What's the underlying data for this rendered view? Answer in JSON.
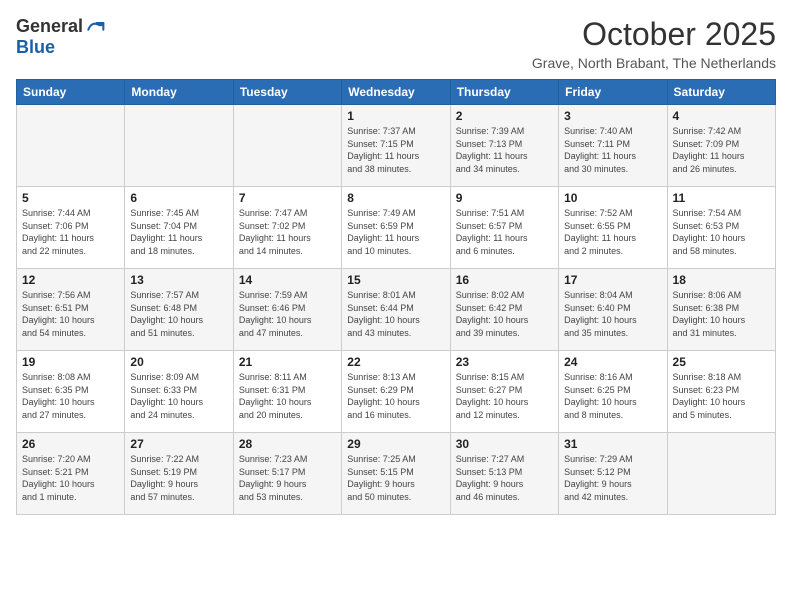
{
  "logo": {
    "general": "General",
    "blue": "Blue"
  },
  "header": {
    "month": "October 2025",
    "location": "Grave, North Brabant, The Netherlands"
  },
  "weekdays": [
    "Sunday",
    "Monday",
    "Tuesday",
    "Wednesday",
    "Thursday",
    "Friday",
    "Saturday"
  ],
  "weeks": [
    [
      {
        "day": "",
        "info": ""
      },
      {
        "day": "",
        "info": ""
      },
      {
        "day": "",
        "info": ""
      },
      {
        "day": "1",
        "info": "Sunrise: 7:37 AM\nSunset: 7:15 PM\nDaylight: 11 hours\nand 38 minutes."
      },
      {
        "day": "2",
        "info": "Sunrise: 7:39 AM\nSunset: 7:13 PM\nDaylight: 11 hours\nand 34 minutes."
      },
      {
        "day": "3",
        "info": "Sunrise: 7:40 AM\nSunset: 7:11 PM\nDaylight: 11 hours\nand 30 minutes."
      },
      {
        "day": "4",
        "info": "Sunrise: 7:42 AM\nSunset: 7:09 PM\nDaylight: 11 hours\nand 26 minutes."
      }
    ],
    [
      {
        "day": "5",
        "info": "Sunrise: 7:44 AM\nSunset: 7:06 PM\nDaylight: 11 hours\nand 22 minutes."
      },
      {
        "day": "6",
        "info": "Sunrise: 7:45 AM\nSunset: 7:04 PM\nDaylight: 11 hours\nand 18 minutes."
      },
      {
        "day": "7",
        "info": "Sunrise: 7:47 AM\nSunset: 7:02 PM\nDaylight: 11 hours\nand 14 minutes."
      },
      {
        "day": "8",
        "info": "Sunrise: 7:49 AM\nSunset: 6:59 PM\nDaylight: 11 hours\nand 10 minutes."
      },
      {
        "day": "9",
        "info": "Sunrise: 7:51 AM\nSunset: 6:57 PM\nDaylight: 11 hours\nand 6 minutes."
      },
      {
        "day": "10",
        "info": "Sunrise: 7:52 AM\nSunset: 6:55 PM\nDaylight: 11 hours\nand 2 minutes."
      },
      {
        "day": "11",
        "info": "Sunrise: 7:54 AM\nSunset: 6:53 PM\nDaylight: 10 hours\nand 58 minutes."
      }
    ],
    [
      {
        "day": "12",
        "info": "Sunrise: 7:56 AM\nSunset: 6:51 PM\nDaylight: 10 hours\nand 54 minutes."
      },
      {
        "day": "13",
        "info": "Sunrise: 7:57 AM\nSunset: 6:48 PM\nDaylight: 10 hours\nand 51 minutes."
      },
      {
        "day": "14",
        "info": "Sunrise: 7:59 AM\nSunset: 6:46 PM\nDaylight: 10 hours\nand 47 minutes."
      },
      {
        "day": "15",
        "info": "Sunrise: 8:01 AM\nSunset: 6:44 PM\nDaylight: 10 hours\nand 43 minutes."
      },
      {
        "day": "16",
        "info": "Sunrise: 8:02 AM\nSunset: 6:42 PM\nDaylight: 10 hours\nand 39 minutes."
      },
      {
        "day": "17",
        "info": "Sunrise: 8:04 AM\nSunset: 6:40 PM\nDaylight: 10 hours\nand 35 minutes."
      },
      {
        "day": "18",
        "info": "Sunrise: 8:06 AM\nSunset: 6:38 PM\nDaylight: 10 hours\nand 31 minutes."
      }
    ],
    [
      {
        "day": "19",
        "info": "Sunrise: 8:08 AM\nSunset: 6:35 PM\nDaylight: 10 hours\nand 27 minutes."
      },
      {
        "day": "20",
        "info": "Sunrise: 8:09 AM\nSunset: 6:33 PM\nDaylight: 10 hours\nand 24 minutes."
      },
      {
        "day": "21",
        "info": "Sunrise: 8:11 AM\nSunset: 6:31 PM\nDaylight: 10 hours\nand 20 minutes."
      },
      {
        "day": "22",
        "info": "Sunrise: 8:13 AM\nSunset: 6:29 PM\nDaylight: 10 hours\nand 16 minutes."
      },
      {
        "day": "23",
        "info": "Sunrise: 8:15 AM\nSunset: 6:27 PM\nDaylight: 10 hours\nand 12 minutes."
      },
      {
        "day": "24",
        "info": "Sunrise: 8:16 AM\nSunset: 6:25 PM\nDaylight: 10 hours\nand 8 minutes."
      },
      {
        "day": "25",
        "info": "Sunrise: 8:18 AM\nSunset: 6:23 PM\nDaylight: 10 hours\nand 5 minutes."
      }
    ],
    [
      {
        "day": "26",
        "info": "Sunrise: 7:20 AM\nSunset: 5:21 PM\nDaylight: 10 hours\nand 1 minute."
      },
      {
        "day": "27",
        "info": "Sunrise: 7:22 AM\nSunset: 5:19 PM\nDaylight: 9 hours\nand 57 minutes."
      },
      {
        "day": "28",
        "info": "Sunrise: 7:23 AM\nSunset: 5:17 PM\nDaylight: 9 hours\nand 53 minutes."
      },
      {
        "day": "29",
        "info": "Sunrise: 7:25 AM\nSunset: 5:15 PM\nDaylight: 9 hours\nand 50 minutes."
      },
      {
        "day": "30",
        "info": "Sunrise: 7:27 AM\nSunset: 5:13 PM\nDaylight: 9 hours\nand 46 minutes."
      },
      {
        "day": "31",
        "info": "Sunrise: 7:29 AM\nSunset: 5:12 PM\nDaylight: 9 hours\nand 42 minutes."
      },
      {
        "day": "",
        "info": ""
      }
    ]
  ]
}
